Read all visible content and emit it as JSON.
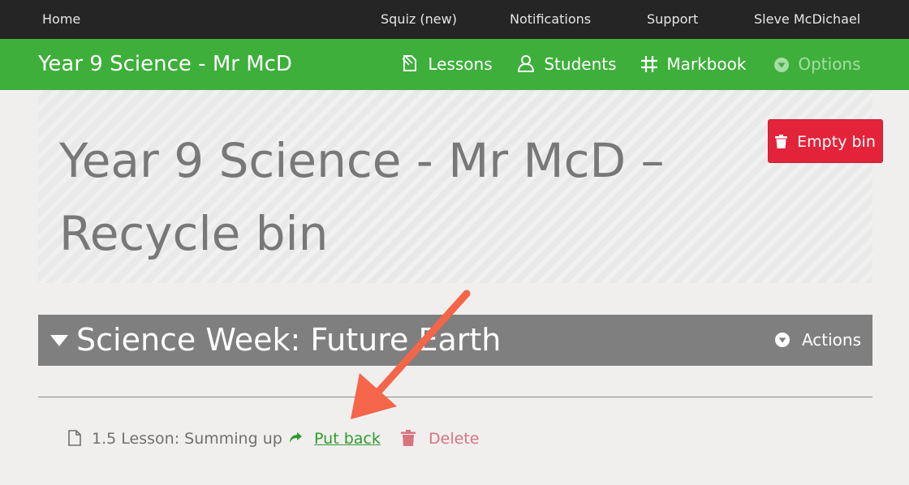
{
  "topbar": {
    "home": "Home",
    "squiz": "Squiz (new)",
    "notifications": "Notifications",
    "support": "Support",
    "user": "Sleve McDichael"
  },
  "classbar": {
    "title": "Year 9 Science - Mr McD",
    "lessons": "Lessons",
    "students": "Students",
    "markbook": "Markbook",
    "options": "Options"
  },
  "hero": {
    "title": "Year 9 Science - Mr McD – Recycle bin",
    "empty_bin_label": "Empty bin"
  },
  "unit": {
    "title": "Science Week: Future Earth",
    "actions_label": "Actions"
  },
  "lessons": [
    {
      "label": "1.5 Lesson: Summing up",
      "put_back": "Put back",
      "delete": "Delete"
    }
  ],
  "icons": {
    "lessons": "lessons-icon",
    "students": "students-icon",
    "markbook": "markbook-grid-icon",
    "options": "caret-circle-icon",
    "empty_bin": "trash-icon",
    "unit_caret": "caret-down-icon",
    "actions": "caret-circle-icon",
    "lesson": "document-icon",
    "put_back": "share-arrow-icon",
    "delete": "trash-icon"
  },
  "colors": {
    "topbar": "#252525",
    "brand_green": "#3daf3a",
    "danger": "#e3233a",
    "unit_bar": "#7f7f7f",
    "annotation_arrow": "#f4654a"
  }
}
